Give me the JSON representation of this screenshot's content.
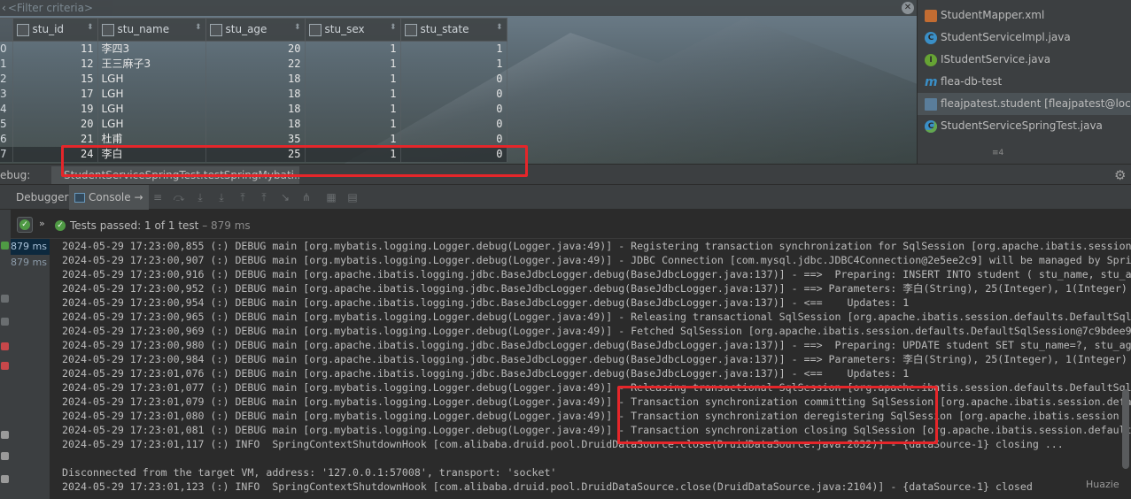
{
  "filter": {
    "placeholder": "<Filter criteria>"
  },
  "table": {
    "columns": [
      "stu_id",
      "stu_name",
      "stu_age",
      "stu_sex",
      "stu_state"
    ],
    "row_numbers": [
      "0",
      "1",
      "2",
      "3",
      "4",
      "5",
      "6",
      "7"
    ],
    "rows": [
      [
        "11",
        "李四3",
        "20",
        "1",
        "1"
      ],
      [
        "12",
        "王三麻子3",
        "22",
        "1",
        "1"
      ],
      [
        "15",
        "LGH",
        "18",
        "1",
        "0"
      ],
      [
        "17",
        "LGH",
        "18",
        "1",
        "0"
      ],
      [
        "19",
        "LGH",
        "18",
        "1",
        "0"
      ],
      [
        "20",
        "LGH",
        "18",
        "1",
        "0"
      ],
      [
        "21",
        "杜甫",
        "35",
        "1",
        "0"
      ],
      [
        "24",
        "李白",
        "25",
        "1",
        "0"
      ]
    ]
  },
  "project_panel": {
    "items": [
      {
        "label": "StudentMapper.xml",
        "icon": "xml-file-icon"
      },
      {
        "label": "StudentServiceImpl.java",
        "icon": "java-class-icon"
      },
      {
        "label": "IStudentService.java",
        "icon": "java-interface-icon"
      },
      {
        "label": "flea-db-test",
        "icon": "maven-module-icon"
      },
      {
        "label": "fleajpatest.student [fleajpatest@localhost",
        "icon": "db-table-icon"
      },
      {
        "label": "StudentServiceSpringTest.java",
        "icon": "java-test-class-icon"
      }
    ],
    "more": "≡4"
  },
  "debug": {
    "label": "ebug:",
    "run_tab": "StudentServiceSpringTest.testSpringMybati...",
    "tabs": {
      "debugger": "Debugger",
      "console": "Console",
      "console_arrow": "→"
    }
  },
  "tests": {
    "passed_label": "Tests passed:",
    "passed_count": "1 of 1 test",
    "passed_time": " – 879 ms"
  },
  "timing": [
    "879 ms",
    "879 ms"
  ],
  "console": {
    "lines": [
      "2024-05-29 17:23:00,855 (:) DEBUG main [org.mybatis.logging.Logger.debug(Logger.java:49)] - Registering transaction synchronization for SqlSession [org.apache.ibatis.session",
      "2024-05-29 17:23:00,907 (:) DEBUG main [org.mybatis.logging.Logger.debug(Logger.java:49)] - JDBC Connection [com.mysql.jdbc.JDBC4Connection@2e5ee2c9] will be managed by Spri",
      "2024-05-29 17:23:00,916 (:) DEBUG main [org.apache.ibatis.logging.jdbc.BaseJdbcLogger.debug(BaseJdbcLogger.java:137)] - ==>  Preparing: INSERT INTO student ( stu_name, stu_a",
      "2024-05-29 17:23:00,952 (:) DEBUG main [org.apache.ibatis.logging.jdbc.BaseJdbcLogger.debug(BaseJdbcLogger.java:137)] - ==> Parameters: 李白(String), 25(Integer), 1(Integer)",
      "2024-05-29 17:23:00,954 (:) DEBUG main [org.apache.ibatis.logging.jdbc.BaseJdbcLogger.debug(BaseJdbcLogger.java:137)] - <==    Updates: 1",
      "2024-05-29 17:23:00,965 (:) DEBUG main [org.mybatis.logging.Logger.debug(Logger.java:49)] - Releasing transactional SqlSession [org.apache.ibatis.session.defaults.DefaultSql",
      "2024-05-29 17:23:00,969 (:) DEBUG main [org.mybatis.logging.Logger.debug(Logger.java:49)] - Fetched SqlSession [org.apache.ibatis.session.defaults.DefaultSqlSession@7c9bdee9",
      "2024-05-29 17:23:00,980 (:) DEBUG main [org.apache.ibatis.logging.jdbc.BaseJdbcLogger.debug(BaseJdbcLogger.java:137)] - ==>  Preparing: UPDATE student SET stu_name=?, stu_ag",
      "2024-05-29 17:23:00,984 (:) DEBUG main [org.apache.ibatis.logging.jdbc.BaseJdbcLogger.debug(BaseJdbcLogger.java:137)] - ==> Parameters: 李白(String), 25(Integer), 1(Integer)",
      "2024-05-29 17:23:01,076 (:) DEBUG main [org.apache.ibatis.logging.jdbc.BaseJdbcLogger.debug(BaseJdbcLogger.java:137)] - <==    Updates: 1",
      "2024-05-29 17:23:01,077 (:) DEBUG main [org.mybatis.logging.Logger.debug(Logger.java:49)] - Releasing transactional SqlSession [org.apache.ibatis.session.defaults.DefaultSql",
      "2024-05-29 17:23:01,079 (:) DEBUG main [org.mybatis.logging.Logger.debug(Logger.java:49)] - Transaction synchronization committing SqlSession [org.apache.ibatis.session.defa",
      "2024-05-29 17:23:01,080 (:) DEBUG main [org.mybatis.logging.Logger.debug(Logger.java:49)] - Transaction synchronization deregistering SqlSession [org.apache.ibatis.session",
      "2024-05-29 17:23:01,081 (:) DEBUG main [org.mybatis.logging.Logger.debug(Logger.java:49)] - Transaction synchronization closing SqlSession [org.apache.ibatis.session.default",
      "2024-05-29 17:23:01,117 (:) INFO  SpringContextShutdownHook [com.alibaba.druid.pool.DruidDataSource.close(DruidDataSource.java:2032)] - {dataSource-1} closing ...",
      "",
      "Disconnected from the target VM, address: '127.0.0.1:57008', transport: 'socket'",
      "2024-05-29 17:23:01,123 (:) INFO  SpringContextShutdownHook [com.alibaba.druid.pool.DruidDataSource.close(DruidDataSource.java:2104)] - {dataSource-1} closed"
    ]
  },
  "watermark": "Huazie",
  "colors": {
    "annotation_red": "#e5262a",
    "pass_green": "#4f9a44",
    "ide_bg": "#2b2b2b"
  }
}
